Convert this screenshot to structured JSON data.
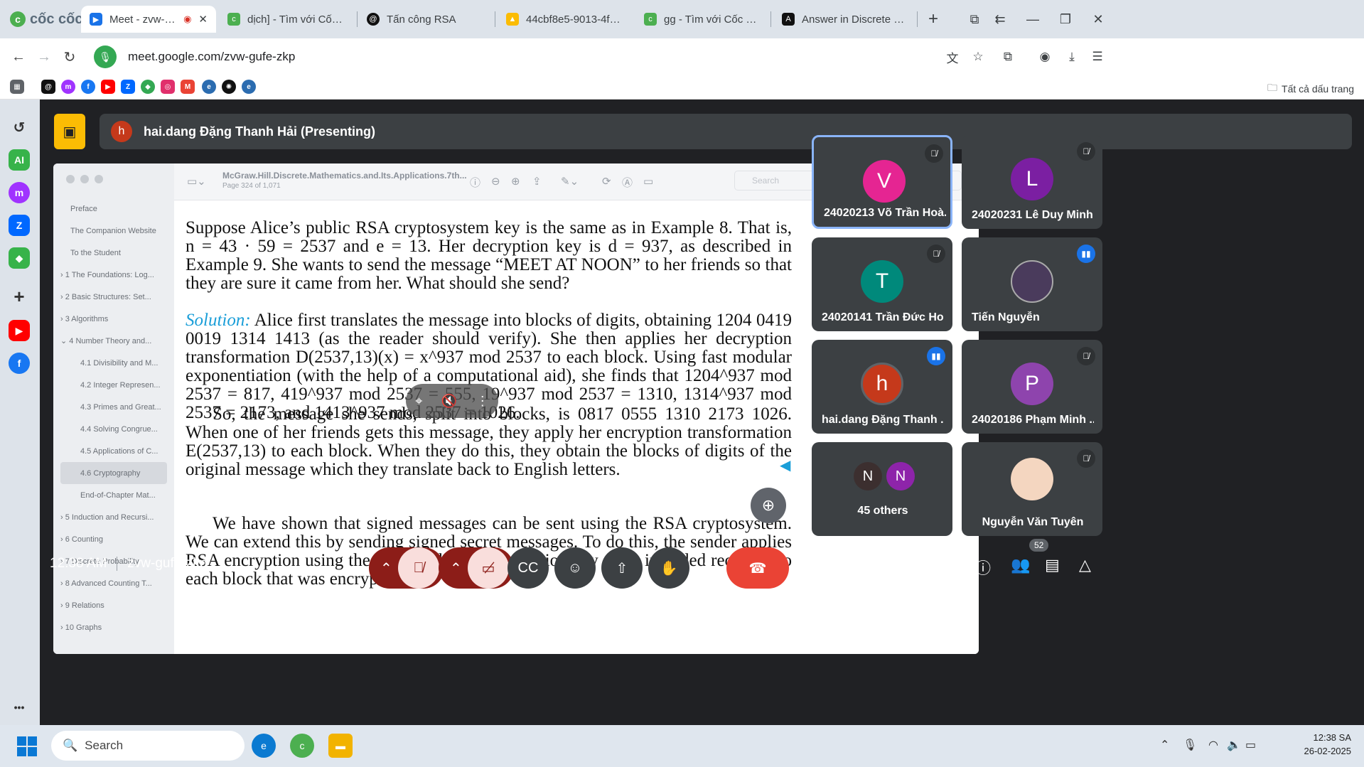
{
  "browser": {
    "brand": "cốc cốc",
    "tabs": [
      {
        "title": "Meet - zvw-gufe-",
        "icon": "meet-icon",
        "active": true
      },
      {
        "title": "dịch] - Tìm với Cốc Cốc",
        "icon": "coccoc-icon"
      },
      {
        "title": "Tấn công RSA",
        "icon": "threads-icon"
      },
      {
        "title": "44cbf8e5-9013-4fbb-ab8",
        "icon": "drive-icon"
      },
      {
        "title": "gg - Tìm với Cốc Cốc",
        "icon": "coccoc-icon"
      },
      {
        "title": "Answer in Discrete Mathe",
        "icon": "answer-icon"
      }
    ],
    "url": "meet.google.com/zvw-gufe-zkp",
    "bookmarks_all": "Tất cả dấu trang"
  },
  "meet": {
    "presenter": "hai.dang Đặng Thanh Hải (Presenting)",
    "presenter_initial": "h",
    "meeting_time": "12:38 AM",
    "meeting_code": "zvw-gufe-zkp",
    "people_count": "52",
    "participants": [
      {
        "name": "24020213 Võ Trần Hoà...",
        "initial": "V",
        "color": "#e52592",
        "muted": true,
        "active": true
      },
      {
        "name": "24020231 Lê Duy Minh",
        "initial": "L",
        "color": "#7b1fa2",
        "muted": true
      },
      {
        "name": "24020141 Trần Đức Ho...",
        "initial": "T",
        "color": "#00897b",
        "muted": true
      },
      {
        "name": "Tiến Nguyễn",
        "initial": "",
        "color": "#4a3b5c",
        "speaking": true
      },
      {
        "name": "hai.dang Đặng Thanh ...",
        "initial": "h",
        "color": "#c5391b",
        "speaking": true
      },
      {
        "name": "24020186 Phạm Minh ...",
        "initial": "P",
        "color": "#8e44ad",
        "muted": true
      },
      {
        "name": "45 others",
        "others": [
          {
            "initial": "N",
            "color": "#3c2f2f"
          },
          {
            "initial": "N",
            "color": "#8e24aa"
          }
        ]
      },
      {
        "name": "Nguyễn Văn Tuyên",
        "initial": "",
        "color": "#f4d6c0",
        "muted": true
      }
    ]
  },
  "pdf": {
    "title": "McGraw.Hill.Discrete.Mathematics.and.Its.Applications.7th...",
    "page": "Page 324 of 1,071",
    "search_placeholder": "Search",
    "toc": [
      {
        "label": "Preface",
        "level": 1
      },
      {
        "label": "The Companion Website",
        "level": 1
      },
      {
        "label": "To the Student",
        "level": 1
      },
      {
        "label": "1 The Foundations: Log...",
        "level": 0
      },
      {
        "label": "2 Basic Structures: Set...",
        "level": 0
      },
      {
        "label": "3 Algorithms",
        "level": 0
      },
      {
        "label": "4 Number Theory and...",
        "level": 0
      },
      {
        "label": "4.1 Divisibility and M...",
        "level": 2
      },
      {
        "label": "4.2 Integer Represen...",
        "level": 2
      },
      {
        "label": "4.3 Primes and Great...",
        "level": 2
      },
      {
        "label": "4.4 Solving Congrue...",
        "level": 2
      },
      {
        "label": "4.5 Applications of C...",
        "level": 2
      },
      {
        "label": "4.6 Cryptography",
        "level": 2,
        "selected": true
      },
      {
        "label": "End-of-Chapter Mat...",
        "level": 2
      },
      {
        "label": "5 Induction and Recursi...",
        "level": 0
      },
      {
        "label": "6 Counting",
        "level": 0
      },
      {
        "label": "7 Discrete Probability",
        "level": 0
      },
      {
        "label": "8 Advanced Counting T...",
        "level": 0
      },
      {
        "label": "9 Relations",
        "level": 0
      },
      {
        "label": "10 Graphs",
        "level": 0
      }
    ],
    "problem": "Suppose Alice’s public RSA cryptosystem key is the same as in Example 8. That is, n = 43 · 59 = 2537 and e = 13. Her decryption key is d = 937, as described in Example 9. She wants to send the message “MEET AT NOON” to her friends so that they are sure it came from her. What should she send?",
    "solution_label": "Solution:",
    "solution": "Alice first translates the message into blocks of digits, obtaining 1204 0419 0019 1314 1413 (as the reader should verify). She then applies her decryption transformation D(2537,13)(x) = x^937 mod 2537 to each block. Using fast modular exponentiation (with the help of a computational aid), she finds that 1204^937 mod 2537 = 817, 419^937 mod 2537 = 555, 19^937 mod 2537 = 1310, 1314^937 mod 2537 = 2173, and 1413^937 mod 2537 = 1026.",
    "solution_2": "So, the message she sends, split into blocks, is 0817 0555 1310 2173 1026. When one of her friends gets this message, they apply her encryption transformation E(2537,13) to each block. When they do this, they obtain the blocks of digits of the original message which they translate back to English letters.",
    "next_para": "We have shown that signed messages can be sent using the RSA cryptosystem. We can extend this by sending signed secret messages. To do this, the sender applies RSA encryption using the publicly known encryption key of an intended recipient to each block that was encrypted"
  },
  "taskbar": {
    "search": "Search",
    "time": "12:38 SA",
    "date": "26-02-2025"
  }
}
